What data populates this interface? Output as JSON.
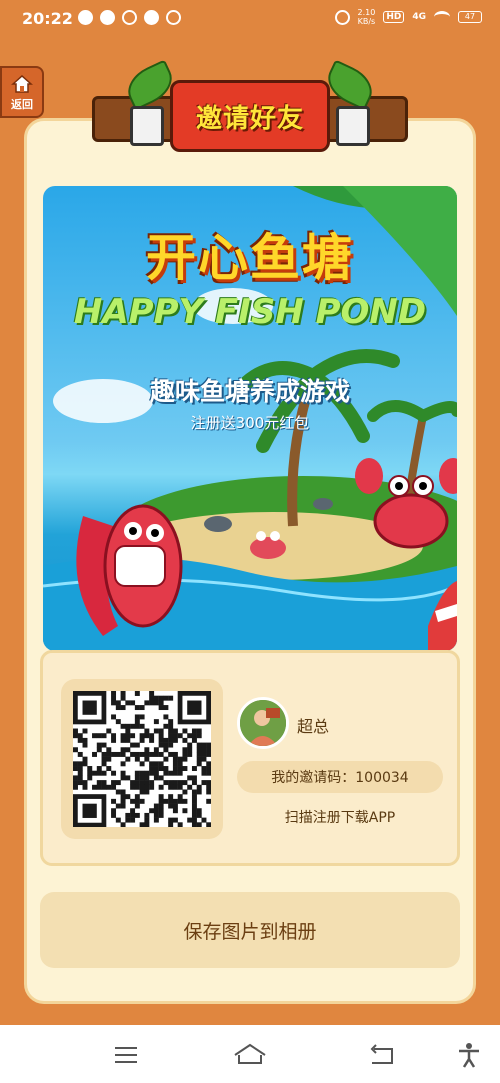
{
  "status_bar": {
    "time": "20:22",
    "speed_value": "2.10",
    "speed_unit": "KB/s",
    "hd": "HD",
    "network": "4G",
    "battery": "47"
  },
  "back_button": {
    "label": "返回"
  },
  "banner": {
    "title": "邀请好友"
  },
  "promo": {
    "title": "开心鱼塘",
    "subtitle_en": "HAPPY FISH POND",
    "tagline": "趣味鱼塘养成游戏",
    "bonus": "注册送300元红包"
  },
  "invite": {
    "user_name": "超总",
    "code_text": "我的邀请码：100034",
    "hint": "扫描注册下载APP"
  },
  "actions": {
    "save_label": "保存图片到相册"
  },
  "colors": {
    "background": "#e0863f",
    "card": "#fdf3d4",
    "accent_red": "#e33b26",
    "title_yellow": "#ffe63a"
  },
  "icons": [
    "home-icon",
    "menu-icon",
    "home-nav-icon",
    "back-nav-icon",
    "accessibility-icon"
  ]
}
